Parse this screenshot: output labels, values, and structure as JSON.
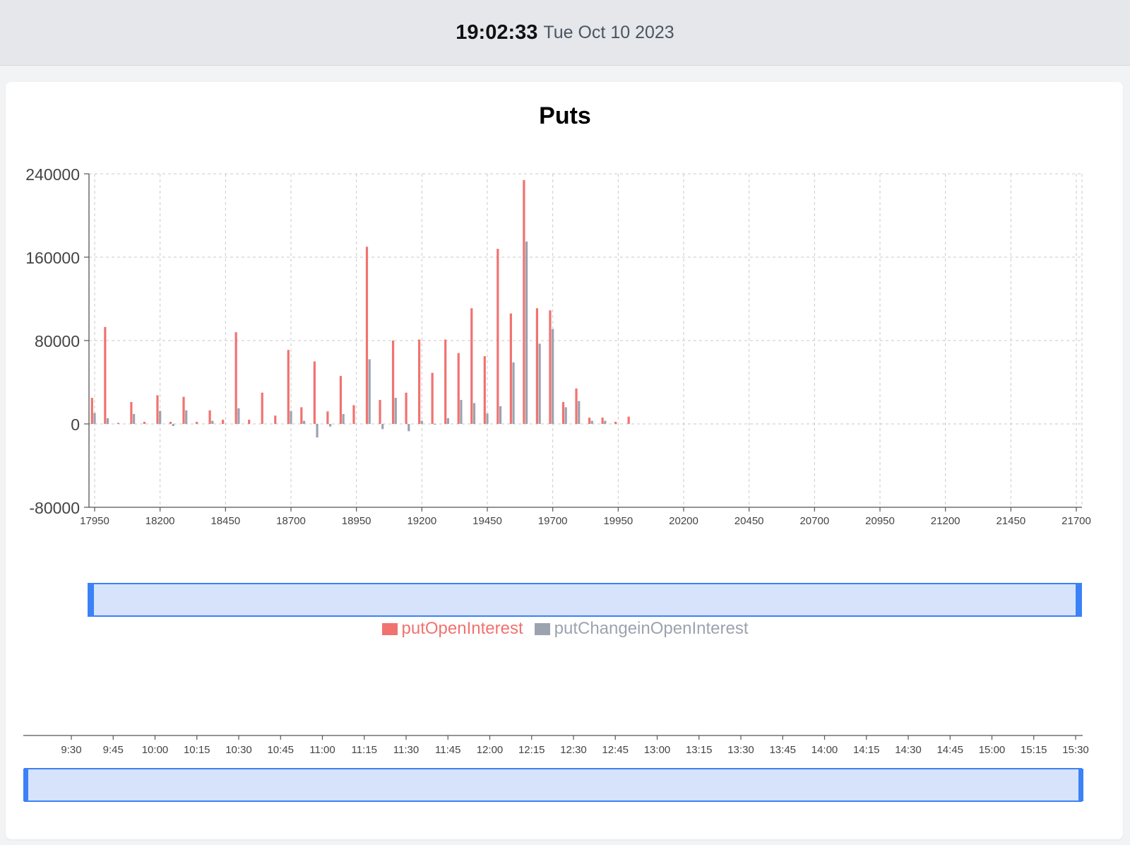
{
  "header": {
    "time": "19:02:33",
    "date": "Tue Oct 10 2023"
  },
  "colors": {
    "put_oi": "#f07370",
    "put_change": "#9ca3af",
    "slider_fill": "#d7e3fb",
    "slider_border": "#3b82f6"
  },
  "legend": {
    "put_oi_label": "putOpenInterest",
    "put_change_label": "putChangeinOpenInterest"
  },
  "chart_data": {
    "type": "bar",
    "title": "Puts",
    "xlabel": "",
    "ylabel": "",
    "xlim": [
      17950,
      21700
    ],
    "ylim": [
      -80000,
      240000
    ],
    "y_ticks": [
      "240000",
      "160000",
      "80000",
      "0",
      "-80000"
    ],
    "x_ticks": [
      17950,
      18200,
      18450,
      18700,
      18950,
      19200,
      19450,
      19700,
      19950,
      20200,
      20450,
      20700,
      20950,
      21200,
      21450,
      21700
    ],
    "grid": true,
    "legend_position": "bottom",
    "series": [
      {
        "name": "putOpenInterest",
        "x": [
          17940,
          17990,
          18040,
          18090,
          18140,
          18190,
          18240,
          18290,
          18340,
          18390,
          18440,
          18490,
          18540,
          18590,
          18640,
          18690,
          18740,
          18790,
          18840,
          18890,
          18940,
          18990,
          19040,
          19090,
          19140,
          19190,
          19240,
          19290,
          19340,
          19390,
          19440,
          19490,
          19540,
          19590,
          19640,
          19690,
          19740,
          19790,
          19840,
          19890,
          19940,
          19990
        ],
        "values": [
          25000,
          93000,
          1000,
          21000,
          2000,
          27500,
          2000,
          26000,
          2000,
          13000,
          4000,
          88000,
          4000,
          30000,
          8000,
          71000,
          16000,
          60000,
          12000,
          46000,
          18000,
          170000,
          23000,
          80000,
          30000,
          81000,
          49000,
          81000,
          68000,
          111000,
          65000,
          168000,
          106000,
          234000,
          111000,
          109000,
          21000,
          34000,
          6000,
          6000,
          2000,
          7000
        ]
      },
      {
        "name": "putChangeinOpenInterest",
        "x": [
          17950,
          18000,
          18050,
          18100,
          18150,
          18200,
          18250,
          18300,
          18350,
          18400,
          18450,
          18500,
          18550,
          18600,
          18650,
          18700,
          18750,
          18800,
          18850,
          18900,
          18950,
          19000,
          19050,
          19100,
          19150,
          19200,
          19250,
          19300,
          19350,
          19400,
          19450,
          19500,
          19550,
          19600,
          19650,
          19700,
          19750,
          19800,
          19850,
          19900,
          19950,
          20000,
          20050,
          20100
        ],
        "values": [
          10500,
          5500,
          0,
          9500,
          0,
          12500,
          -2000,
          13000,
          0,
          3000,
          0,
          15000,
          0,
          0,
          0,
          12500,
          3000,
          -13000,
          -2500,
          9500,
          0,
          62000,
          -5000,
          25000,
          -7000,
          3000,
          -500,
          5500,
          23000,
          20000,
          10000,
          17000,
          59000,
          175000,
          77000,
          91000,
          16000,
          22000,
          3000,
          3000,
          0,
          0,
          0,
          0
        ]
      }
    ]
  },
  "time_axis": {
    "ticks": [
      "9:30",
      "9:45",
      "10:00",
      "10:15",
      "10:30",
      "10:45",
      "11:00",
      "11:15",
      "11:30",
      "11:45",
      "12:00",
      "12:15",
      "12:30",
      "12:45",
      "13:00",
      "13:15",
      "13:30",
      "13:45",
      "14:00",
      "14:15",
      "14:30",
      "14:45",
      "15:00",
      "15:15",
      "15:30"
    ]
  }
}
